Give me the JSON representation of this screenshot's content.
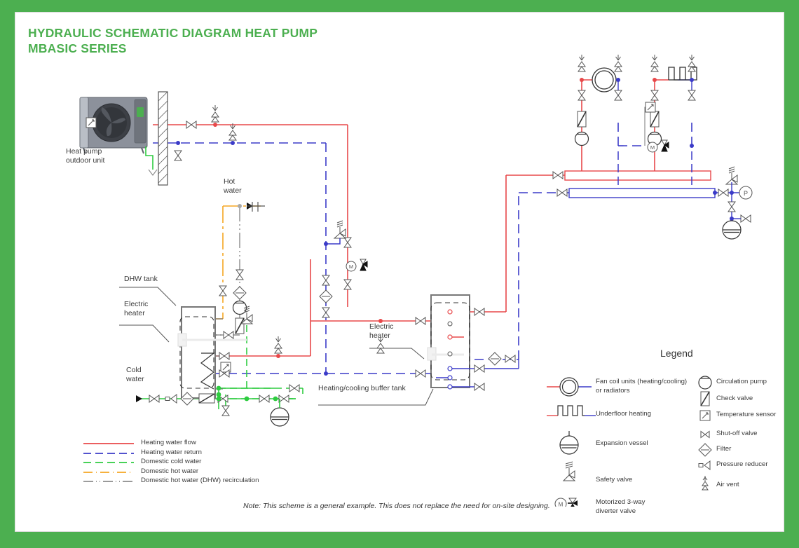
{
  "page": {
    "title": "HYDRAULIC SCHEMATIC DIAGRAM HEAT PUMP\nMBASIC SERIES",
    "border_color": "#4CAF50",
    "background": "#ffffff",
    "note": "Note: This scheme is a general example. This does not replace the need for on-site designing."
  },
  "colors": {
    "heating_flow": "#e8484a",
    "heating_return": "#3b3bc8",
    "cold_water": "#2ecc40",
    "hot_water": "#f5a623",
    "dhw_recirc": "#8c8c8c",
    "outline": "#555555",
    "title": "#4CAF50",
    "text": "#3a3a3a"
  },
  "labels": {
    "heat_pump": "Heat pump\noutdoor unit",
    "hot_water": "Hot\nwater",
    "dhw_tank": "DHW tank",
    "electric_heater_dhw": "Electric\nheater",
    "cold_water": "Cold\nwater",
    "electric_heater_buffer": "Electric\nheater",
    "buffer_tank": "Heating/cooling buffer tank"
  },
  "line_legend": {
    "items": [
      {
        "label": "Heating water flow",
        "color": "#e8484a",
        "style": "solid"
      },
      {
        "label": "Heating water return",
        "color": "#3b3bc8",
        "style": "dashed"
      },
      {
        "label": "Domestic cold water",
        "color": "#2ecc40",
        "style": "dashed"
      },
      {
        "label": "Domestic hot water",
        "color": "#f5a623",
        "style": "dashdot"
      },
      {
        "label": "Domestic hot water (DHW) recirculation",
        "color": "#8c8c8c",
        "style": "dashdotdot"
      }
    ]
  },
  "legend": {
    "title": "Legend",
    "column_left": [
      {
        "icon": "fan-coil-icon",
        "label": "Fan coil units (heating/cooling)\nor radiators"
      },
      {
        "icon": "underfloor-icon",
        "label": "Underfloor heating"
      },
      {
        "icon": "expansion-vessel-icon",
        "label": "Expansion vessel"
      },
      {
        "icon": "safety-valve-icon",
        "label": "Safety valve"
      },
      {
        "icon": "motorized-3way-icon",
        "label": "Motorized 3-way\ndiverter valve"
      }
    ],
    "column_right": [
      {
        "icon": "circulation-pump-icon",
        "label": "Circulation pump"
      },
      {
        "icon": "check-valve-icon",
        "label": "Check valve"
      },
      {
        "icon": "temperature-sensor-icon",
        "label": "Temperature sensor"
      },
      {
        "icon": "shutoff-valve-icon",
        "label": "Shut-off valve"
      },
      {
        "icon": "filter-icon",
        "label": "Filter"
      },
      {
        "icon": "pressure-reducer-icon",
        "label": "Pressure reducer"
      },
      {
        "icon": "air-vent-icon",
        "label": "Air vent"
      }
    ]
  },
  "components": {
    "heat_pump_outdoor_unit": "heat-pump-outdoor-unit",
    "wall": "building-wall",
    "dhw_tank": "dhw-tank",
    "buffer_tank": "heating-cooling-buffer-tank",
    "fan_coil": "fan-coil-unit",
    "underfloor_heating": "underfloor-heating-coil",
    "manifold_flow": "manifold-supply",
    "manifold_return": "manifold-return",
    "expansion_vessel_heating": "expansion-vessel-heating",
    "expansion_vessel_dhw": "expansion-vessel-dhw",
    "pressure_gauge": "pressure-gauge-P"
  }
}
